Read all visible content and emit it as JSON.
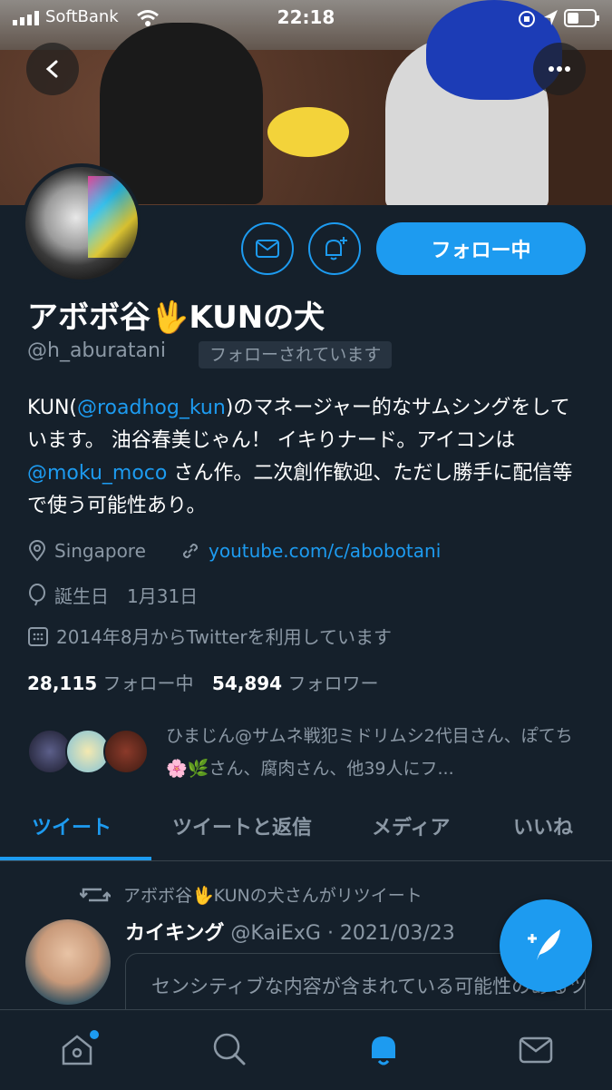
{
  "status_bar": {
    "carrier": "SoftBank",
    "time": "22:18"
  },
  "profile": {
    "display_name": "アボボ谷🖖KUNの犬",
    "handle": "@h_aburatani",
    "follows_you": "フォローされています",
    "follow_label": "フォロー中",
    "bio": {
      "p1": "KUN(",
      "mention1": "@roadhog_kun",
      "p2": ")のマネージャー的なサムシングをしています。 油谷春美じゃん！ イキりナード。アイコンは",
      "mention2": "@moku_moco",
      "p3": " さん作。二次創作歓迎、ただし勝手に配信等で使う可能性あり。"
    },
    "location": "Singapore",
    "website": "youtube.com/c/abobotani",
    "birthday": "誕生日　1月31日",
    "joined": "2014年8月からTwitterを利用しています",
    "following_count": "28,115",
    "following_label": "フォロー中",
    "followers_count": "54,894",
    "followers_label": "フォロワー",
    "known_followers": "ひまじん@サムネ戦犯ミドリムシ2代目さん、ぽてち🌸🌿さん、腐肉さん、他39人にフ..."
  },
  "tabs": [
    {
      "label": "ツイート"
    },
    {
      "label": "ツイートと返信"
    },
    {
      "label": "メディア"
    },
    {
      "label": "いいね"
    }
  ],
  "tweet": {
    "retweet_notice": "アボボ谷🖖KUNの犬さんがリツイート",
    "author_name": "カイキング",
    "author_meta": "@KaiExG · 2021/03/23",
    "sensitive_text": "センシティブな内容が含まれている可能性のあるツイートです。"
  },
  "colors": {
    "accent": "#1d9bf0",
    "background": "#15202b",
    "muted": "#8b98a5"
  },
  "icons": {
    "back": "chevron-left-icon",
    "more": "more-dots-icon",
    "message": "mail-icon",
    "notify": "bell-plus-icon",
    "location": "location-pin-icon",
    "link": "link-icon",
    "birthday": "balloon-icon",
    "calendar": "calendar-icon",
    "retweet": "retweet-icon",
    "compose": "feather-plus-icon",
    "home": "home-icon",
    "search": "search-icon",
    "notifications": "bell-icon",
    "messages": "mail-icon"
  }
}
